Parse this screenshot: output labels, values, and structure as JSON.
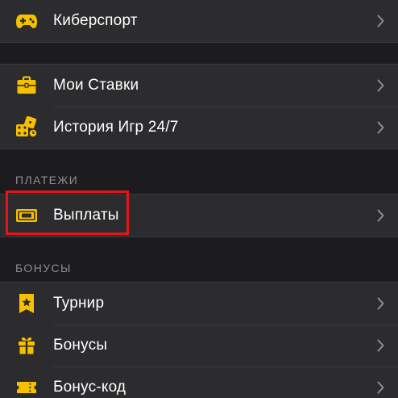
{
  "colors": {
    "accent": "#f5c000",
    "background": "#1c1c1e",
    "row_background": "#2c2c2e",
    "highlight": "#e3141b"
  },
  "menu": {
    "esports": {
      "label": "Киберспорт",
      "icon": "gamepad-icon"
    },
    "my_bets": {
      "label": "Мои Ставки",
      "icon": "briefcase-icon"
    },
    "game_history": {
      "label": "История Игр 24/7",
      "icon": "dice-icon"
    }
  },
  "payments": {
    "header": "ПЛАТЕЖИ",
    "payouts": {
      "label": "Выплаты",
      "icon": "banknote-icon"
    }
  },
  "bonuses": {
    "header": "БОНУСЫ",
    "tournament": {
      "label": "Турнир",
      "icon": "ribbon-star-icon"
    },
    "bonuses": {
      "label": "Бонусы",
      "icon": "gift-icon"
    },
    "promo_code": {
      "label": "Бонус-код",
      "icon": "ticket-icon"
    }
  }
}
